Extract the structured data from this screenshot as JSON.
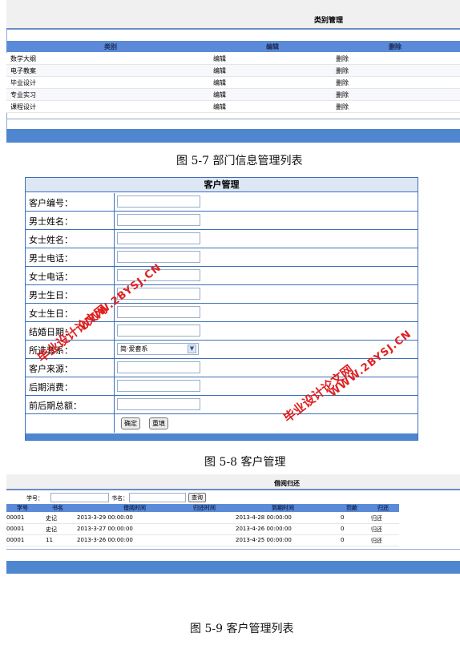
{
  "category_panel": {
    "title": "类别管理",
    "columns": [
      "类别",
      "编辑",
      "删除"
    ],
    "rows": [
      {
        "category": "数学大纲",
        "edit": "编辑",
        "delete": "删除"
      },
      {
        "category": "电子教案",
        "edit": "编辑",
        "delete": "删除"
      },
      {
        "category": "毕业设计",
        "edit": "编辑",
        "delete": "删除"
      },
      {
        "category": "专业实习",
        "edit": "编辑",
        "delete": "删除"
      },
      {
        "category": "课程设计",
        "edit": "编辑",
        "delete": "删除"
      }
    ]
  },
  "caption1": "图 5-7 部门信息管理列表",
  "customer_form": {
    "title": "客户管理",
    "fields": [
      "客户编号：",
      "男士姓名：",
      "女士姓名：",
      "男士电话：",
      "女士电话：",
      "男士生日：",
      "女士生日：",
      "结婚日期：",
      "所选套系：",
      "客户来源：",
      "后期消费：",
      "前后期总额："
    ],
    "package_value": "简·爱套系",
    "confirm_button": "确定",
    "reset_button": "重填"
  },
  "watermarks": {
    "left_cn": "毕业设计论文网",
    "left_url": "WWW.2BYSJ.CN",
    "right_cn": "毕业设计论文网",
    "right_url": "WWW.2BYSJ.CN"
  },
  "caption2": "图 5-8 客户管理",
  "borrow_panel": {
    "title": "借阅归还",
    "search_student_label": "学号：",
    "search_book_label": "书名：",
    "query_button": "查询",
    "columns": [
      "学号",
      "书名",
      "借阅时间",
      "归还时间",
      "到期时间",
      "罚款",
      "归还"
    ],
    "rows": [
      {
        "id": "00001",
        "book": "史记",
        "borrow": "2013-3-29 00:00:00",
        "returned": "",
        "due": "2013-4-28 00:00:00",
        "fine": "0",
        "action": "归还"
      },
      {
        "id": "00001",
        "book": "史记",
        "borrow": "2013-3-27 00:00:00",
        "returned": "",
        "due": "2013-4-26 00:00:00",
        "fine": "0",
        "action": "归还"
      },
      {
        "id": "00001",
        "book": "11",
        "borrow": "2013-3-26 00:00:00",
        "returned": "",
        "due": "2013-4-25 00:00:00",
        "fine": "0",
        "action": "归还"
      }
    ]
  },
  "caption3": "图 5-9 客户管理列表",
  "colors": {
    "header_blue": "#5b8bd8",
    "footer_blue": "#4f86d0",
    "watermark_red": "#e02020",
    "border_blue": "#3d6fb8"
  }
}
